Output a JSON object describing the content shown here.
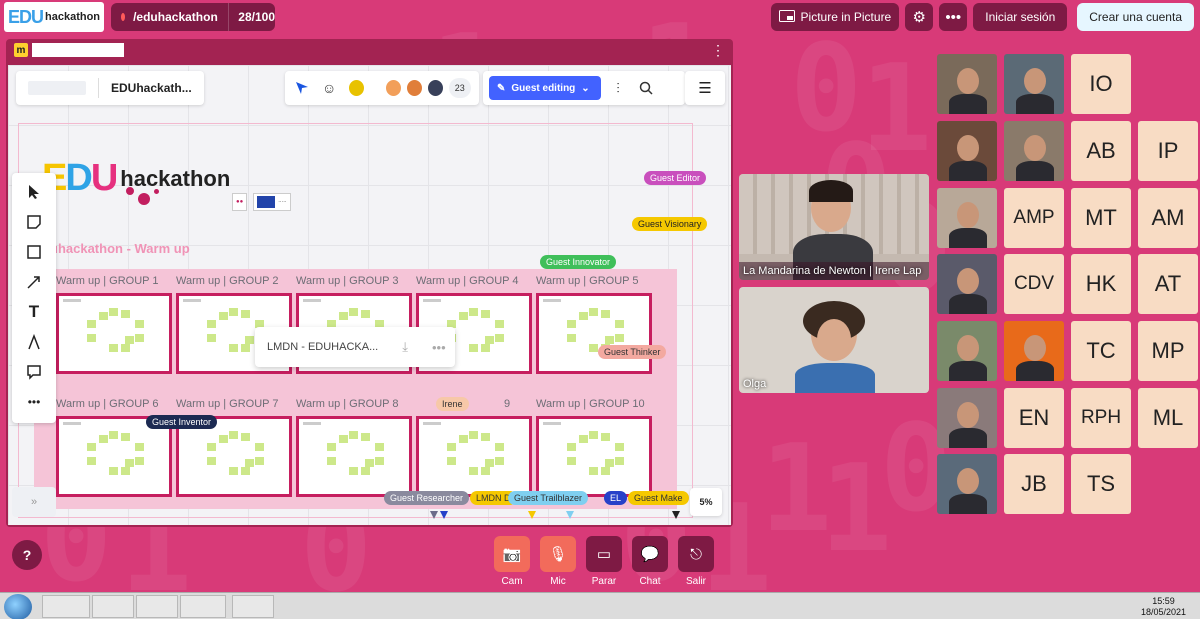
{
  "topbar": {
    "logo_edu": "EDU",
    "logo_text": "hackathon",
    "room_name": "/eduhackathon",
    "participant_count": "28/100",
    "pip_label": "Picture in Picture",
    "settings_icon": "gear-icon",
    "more_icon": "ellipsis-icon",
    "login_label": "Iniciar sesión",
    "signup_label": "Crear una cuenta"
  },
  "whiteboard": {
    "board_name": "EDUhackath...",
    "guest_editing_label": "Guest editing",
    "collaborators_count": "23",
    "zoom": "5%",
    "frame": {
      "logo_edu": "EDU",
      "logo_text": "hackathon",
      "section_title": "uhackathon - Warm up",
      "groups": [
        {
          "label": "Warm up | GROUP 1"
        },
        {
          "label": "Warm up | GROUP 2"
        },
        {
          "label": "Warm up | GROUP 3"
        },
        {
          "label": "Warm up | GROUP 4"
        },
        {
          "label": "Warm up | GROUP 5"
        },
        {
          "label": "Warm up | GROUP 6"
        },
        {
          "label": "Warm up | GROUP 7"
        },
        {
          "label": "Warm up | GROUP 8"
        },
        {
          "label": "9"
        },
        {
          "label": "Warm up | GROUP 10"
        }
      ]
    },
    "popup": {
      "file_name": "LMDN - EDUHACKA..."
    },
    "cursors": [
      {
        "name": "Guest Editor",
        "color": "#c94fbd"
      },
      {
        "name": "Guest Visionary",
        "color": "#f5c800"
      },
      {
        "name": "Guest Innovator",
        "color": "#3fbf5a"
      },
      {
        "name": "Guest Thinker",
        "color": "#f3a9a0"
      },
      {
        "name": "Guest Inventor",
        "color": "#1c2a52"
      },
      {
        "name": "Irene",
        "color": "#f7c8a8"
      },
      {
        "name": "Guest Researcher",
        "color": "#8a8a9e"
      },
      {
        "name": "LMDN D",
        "color": "#f5c800"
      },
      {
        "name": "Guest Trailblazer",
        "color": "#7fcff0"
      },
      {
        "name": "EL",
        "color": "#2741c9"
      },
      {
        "name": "Guest Make",
        "color": "#f5c800"
      }
    ]
  },
  "videos": {
    "main_1_caption": "La Mandarina de Newton | Irene Lap",
    "main_2_caption": "Olga"
  },
  "tiles": [
    "IO",
    "AB",
    "IP",
    "AMP",
    "MT",
    "AM",
    "CDV",
    "HK",
    "AT",
    "TC",
    "MP",
    "EN",
    "RPH",
    "ML",
    "JB",
    "TS"
  ],
  "controls": [
    {
      "label": "Cam",
      "icon": "camera-off-icon",
      "color": "#f26b5b"
    },
    {
      "label": "Mic",
      "icon": "mic-off-icon",
      "color": "#f26b5b"
    },
    {
      "label": "Parar",
      "icon": "screen-share-icon",
      "color": "#7e1a44"
    },
    {
      "label": "Chat",
      "icon": "chat-icon",
      "color": "#7e1a44"
    },
    {
      "label": "Salir",
      "icon": "exit-icon",
      "color": "#7e1a44"
    }
  ],
  "taskbar": {
    "time": "15:59",
    "date": "18/05/2021"
  }
}
